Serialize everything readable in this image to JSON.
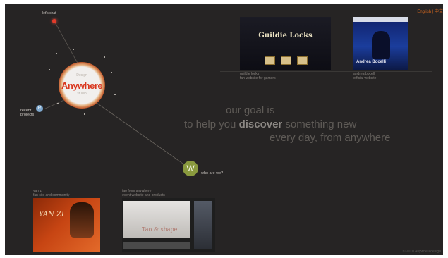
{
  "header": {
    "lang_english": "English",
    "lang_separator": "|",
    "lang_chinese": "中文"
  },
  "nav": {
    "lets_chat": "let's chat",
    "recent_projects_icon": "R",
    "recent_projects_line1": "recent",
    "recent_projects_line2": "projects",
    "who_icon": "W",
    "who_are_we": "who are we?"
  },
  "logo": {
    "brand": "Anywhere",
    "tagline_top": "Design",
    "tagline_bottom": "studio"
  },
  "slogan": {
    "line1": "our goal is",
    "line2_pre": "to help you ",
    "line2_bold": "discover",
    "line2_post": " something new",
    "line3": "every day, from anywhere"
  },
  "projects": [
    {
      "caption1": "guildie locks",
      "caption2": "fan website for gamers",
      "screen_title": "Guildie Locks"
    },
    {
      "caption1": "andrea bocelli",
      "caption2": "official website",
      "screen_title": "Andrea Bocelli"
    },
    {
      "caption1": "yan zi",
      "caption2": "fan site and community",
      "screen_title": "YAN ZI"
    },
    {
      "caption1": "tao from anywhere",
      "caption2": "event website and products",
      "screen_title": "Tao & shape"
    }
  ],
  "footer": {
    "copyright": "© 2010 Anywheredesign"
  },
  "colors": {
    "background": "#262424",
    "accent": "#d2661f",
    "slogan": "#5f5b57",
    "highlight": "#8c8884"
  }
}
